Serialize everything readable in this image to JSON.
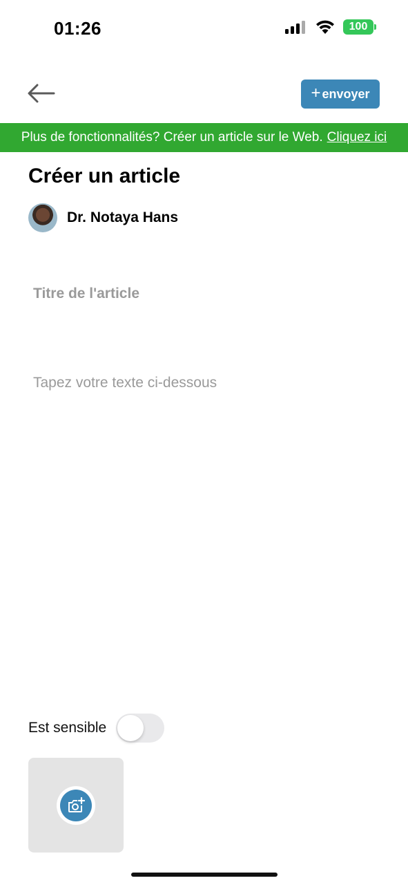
{
  "status_bar": {
    "time": "01:26",
    "battery": "100",
    "icons": [
      "signal-icon",
      "wifi-icon",
      "battery-icon"
    ]
  },
  "header": {
    "back_icon": "arrow-left-icon",
    "send_label": "envoyer",
    "send_plus": "+",
    "accent": "#3c87b7"
  },
  "banner": {
    "text": "Plus de fonctionnalités? Créer un article sur le Web.",
    "link": "Cliquez ici",
    "color": "#31a831"
  },
  "page": {
    "title": "Créer un article"
  },
  "author": {
    "name": "Dr. Notaya Hans"
  },
  "form": {
    "title_placeholder": "Titre de l'article",
    "title_value": "",
    "body_placeholder": "Tapez votre texte ci-dessous",
    "body_value": "",
    "sensitive_label": "Est sensible",
    "sensitive_on": false,
    "photo_icon": "add-photo-icon"
  }
}
